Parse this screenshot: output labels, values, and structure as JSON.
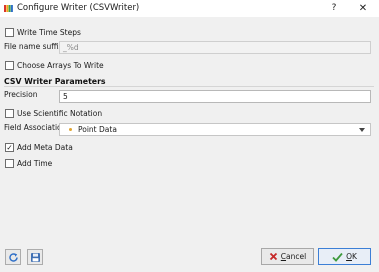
{
  "window": {
    "title": "Configure Writer (CSVWriter)",
    "help_label": "?",
    "close_label": "✕"
  },
  "options": {
    "write_time_steps": {
      "label": "Write Time Steps",
      "checked": false
    },
    "file_name_suffix": {
      "label": "File name suffix",
      "value": "_%d",
      "disabled": true
    },
    "choose_arrays": {
      "label": "Choose Arrays To Write",
      "checked": false
    }
  },
  "csv_params": {
    "section_title": "CSV Writer Parameters",
    "precision": {
      "label": "Precision",
      "value": "5"
    },
    "scientific_notation": {
      "label": "Use Scientific Notation",
      "checked": false
    },
    "field_association": {
      "label": "Field Association",
      "selected": "Point Data",
      "dot_color": "#e0a431"
    },
    "add_meta_data": {
      "label": "Add Meta Data",
      "checked": true,
      "check_glyph": "✓"
    },
    "add_time": {
      "label": "Add Time",
      "checked": false
    }
  },
  "buttons": {
    "reset_icon": "refresh-icon",
    "save_icon": "save-icon",
    "cancel_label_prefix": "",
    "cancel_label_underlined": "C",
    "cancel_label_rest": "ancel",
    "ok_label_underlined": "O",
    "ok_label_rest": "K"
  },
  "colors": {
    "accent": "#3c7fd6",
    "titlebar": "#ffffff",
    "body": "#f0f0f0"
  }
}
